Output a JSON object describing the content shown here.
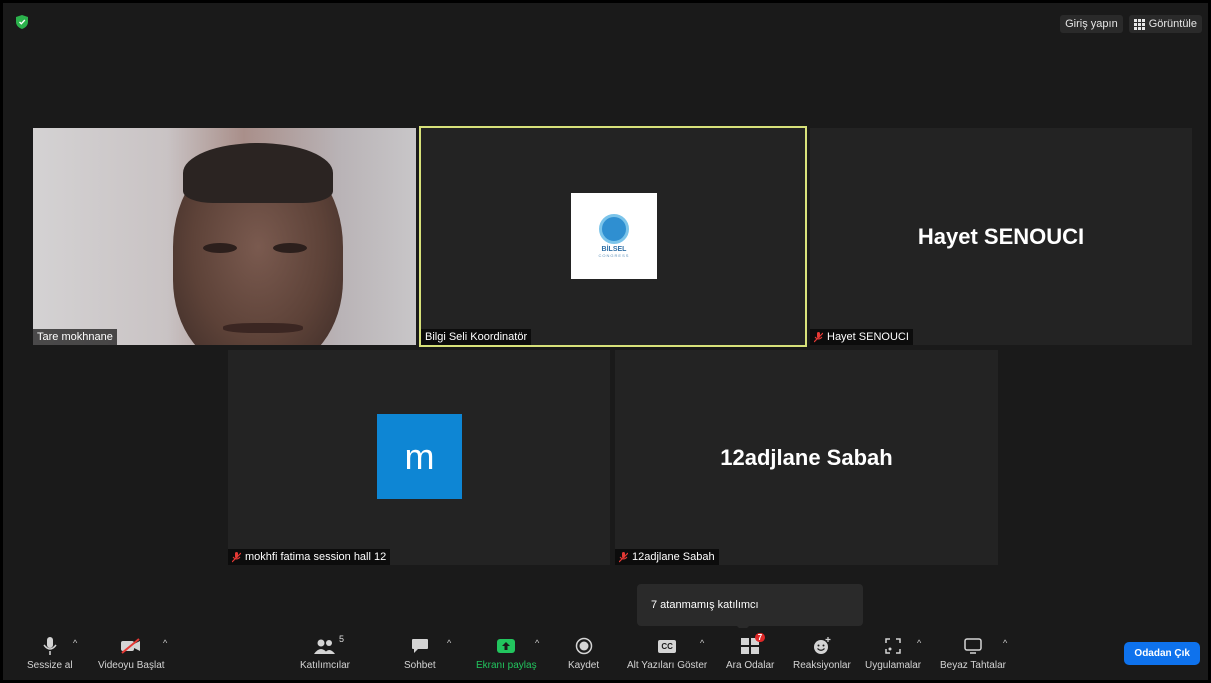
{
  "top": {
    "signin_label": "Giriş yapın",
    "view_label": "Görüntüle"
  },
  "tiles": {
    "tare": {
      "name": "Tare mokhnane"
    },
    "bilgi": {
      "name": "Bilgi Seli Koordinatör",
      "logo_text": "BİLSEL",
      "logo_sub": "CONGRESS"
    },
    "hayet": {
      "display": "Hayet SENOUCI",
      "name": "Hayet SENOUCI"
    },
    "mokhfi": {
      "avatar_letter": "m",
      "name": "mokhfi fatima  session hall 12"
    },
    "sabah": {
      "display": "12adjlane Sabah",
      "name": "12adjlane Sabah"
    }
  },
  "tooltip": {
    "text": "7 atanmamış katılımcı"
  },
  "toolbar": {
    "mute": "Sessize al",
    "video": "Videoyu Başlat",
    "participants": "Katılımcılar",
    "participants_count": "5",
    "chat": "Sohbet",
    "share": "Ekranı paylaş",
    "record": "Kaydet",
    "captions": "Alt Yazıları Göster",
    "breakout": "Ara Odalar",
    "breakout_badge": "7",
    "reactions": "Reaksiyonlar",
    "apps": "Uygulamalar",
    "whiteboards": "Beyaz Tahtalar",
    "leave": "Odadan Çık",
    "cc": "CC"
  },
  "colors": {
    "active_speaker_border": "#d7e17a",
    "share_green": "#22c55e",
    "leave_blue": "#0e72ed",
    "badge_red": "#e02828"
  }
}
